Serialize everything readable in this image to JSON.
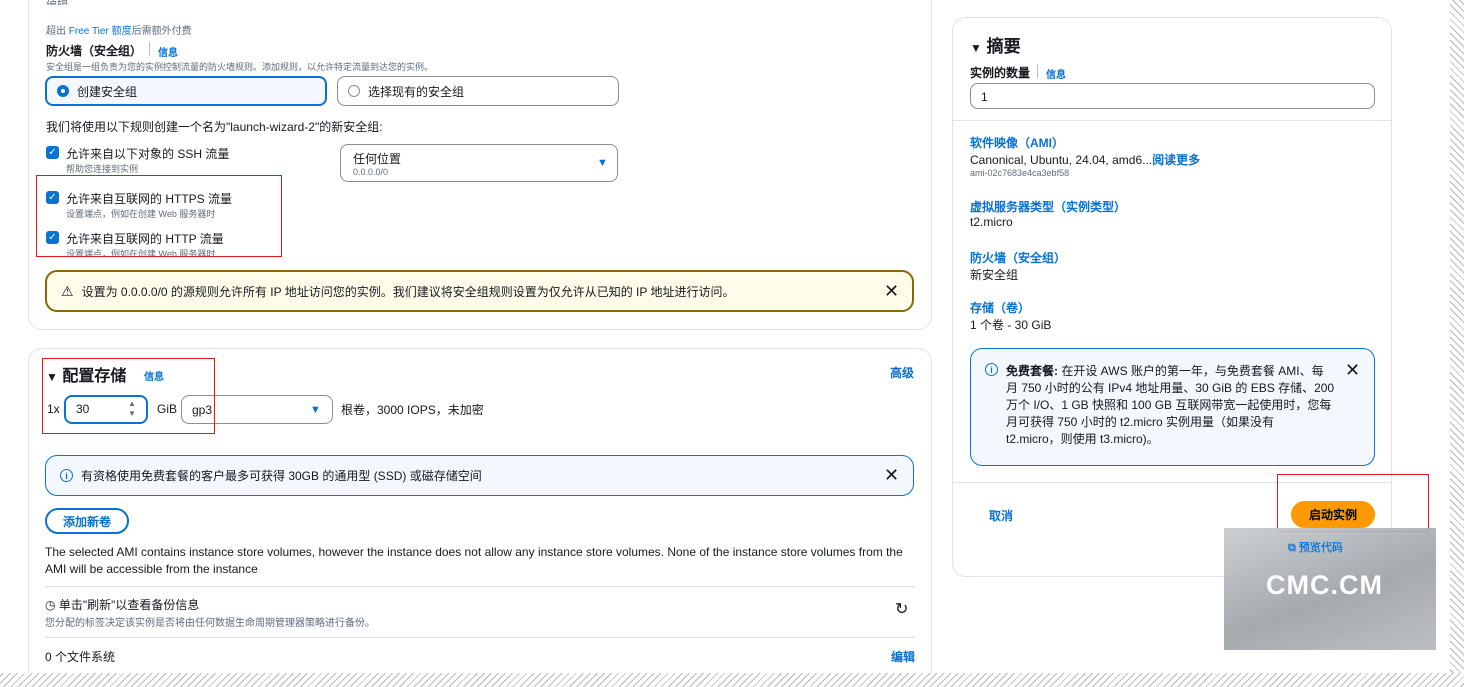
{
  "firewall": {
    "top_cut_label": "编辑",
    "free_tier_note_prefix": "超出",
    "free_tier_link": "Free Tier 额度",
    "free_tier_note_suffix": "后需额外付费",
    "title": "防火墙（安全组）",
    "info": "信息",
    "description": "安全组是一组负责为您的实例控制流量的防火墙规则。添加规则，以允许特定流量到达您的实例。",
    "option_create": "创建安全组",
    "option_existing": "选择现有的安全组",
    "rules_intro": "我们将使用以下规则创建一个名为\"launch-wizard-2\"的新安全组:",
    "rules": [
      {
        "label": "允许来自以下对象的 SSH 流量",
        "hint": "帮助您连接到实例",
        "checked": true
      },
      {
        "label": "允许来自互联网的 HTTPS 流量",
        "hint": "设置端点，例如在创建 Web 服务器时",
        "checked": true
      },
      {
        "label": "允许来自互联网的 HTTP 流量",
        "hint": "设置端点，例如在创建 Web 服务器时",
        "checked": true
      }
    ],
    "ssh_source": {
      "value": "任何位置",
      "sub": "0.0.0.0/0"
    },
    "warning": "设置为 0.0.0.0/0 的源规则允许所有 IP 地址访问您的实例。我们建议将安全组规则设置为仅允许从已知的 IP 地址进行访问。"
  },
  "storage": {
    "title": "配置存储",
    "info": "信息",
    "advanced": "高级",
    "multiplier": "1x",
    "size": "30",
    "unit": "GiB",
    "volume_type": "gp3",
    "root_note": "根卷，3000 IOPS，未加密",
    "free_info": "有资格使用免费套餐的客户最多可获得 30GB 的通用型 (SSD) 或磁存储空间",
    "add_volume": "添加新卷",
    "ami_note": "The selected AMI contains instance store volumes, however the instance does not allow any instance store volumes. None of the instance store volumes from the AMI will be accessible from the instance",
    "backup_title": "单击\"刷新\"以查看备份信息",
    "backup_desc": "您分配的标签决定该实例是否将由任何数据生命周期管理器策略进行备份。",
    "filesystems": "0 个文件系统",
    "edit": "编辑"
  },
  "summary": {
    "title": "摘要",
    "count_label": "实例的数量",
    "info": "信息",
    "count_value": "1",
    "ami_heading": "软件映像（AMI）",
    "ami_value": "Canonical, Ubuntu, 24.04, amd6...",
    "ami_read_more": "阅读更多",
    "ami_id": "ami-02c7683e4ca3ebf58",
    "type_heading": "虚拟服务器类型（实例类型）",
    "type_value": "t2.micro",
    "fw_heading": "防火墙（安全组）",
    "fw_value": "新安全组",
    "storage_heading": "存储（卷）",
    "storage_value": "1 个卷 - 30 GiB",
    "free_tier_bold": "免费套餐:",
    "free_tier_lines": [
      "在开设 AWS 账户的第一年，与免费套餐 AMI、每",
      "月 750 小时的公有 IPv4 地址用量、30 GiB 的 EBS 存储、200",
      "万个 I/O、1 GB 快照和 100 GB 互联网带宽一起使用时，您每",
      "月可获得 750 小时的 t2.micro 实例用量（如果没有",
      "t2.micro，则使用 t3.micro)。"
    ],
    "cancel": "取消",
    "launch": "启动实例",
    "preview_code": "预览代码"
  },
  "watermark": {
    "text": "CMC.CM"
  },
  "colors": {
    "accent": "#0972d3",
    "primary_button": "#ff9900",
    "warning_border": "#8d6605",
    "highlight": "#e0191f"
  }
}
